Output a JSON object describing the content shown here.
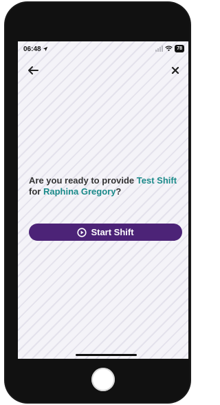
{
  "status_bar": {
    "time": "06:48",
    "battery": "78"
  },
  "prompt": {
    "prefix": "Are you ready to provide ",
    "service": "Test Shift",
    "middle": " for ",
    "client": "Raphina Gregory",
    "suffix": "?"
  },
  "actions": {
    "start_label": "Start Shift"
  },
  "colors": {
    "accent_button": "#4c2377",
    "highlight_text": "#1b8a8a"
  },
  "icons": {
    "back": "arrow-left",
    "close": "x",
    "start": "play-circle",
    "location": "location-arrow",
    "wifi": "wifi",
    "signal": "cellular-signal"
  }
}
